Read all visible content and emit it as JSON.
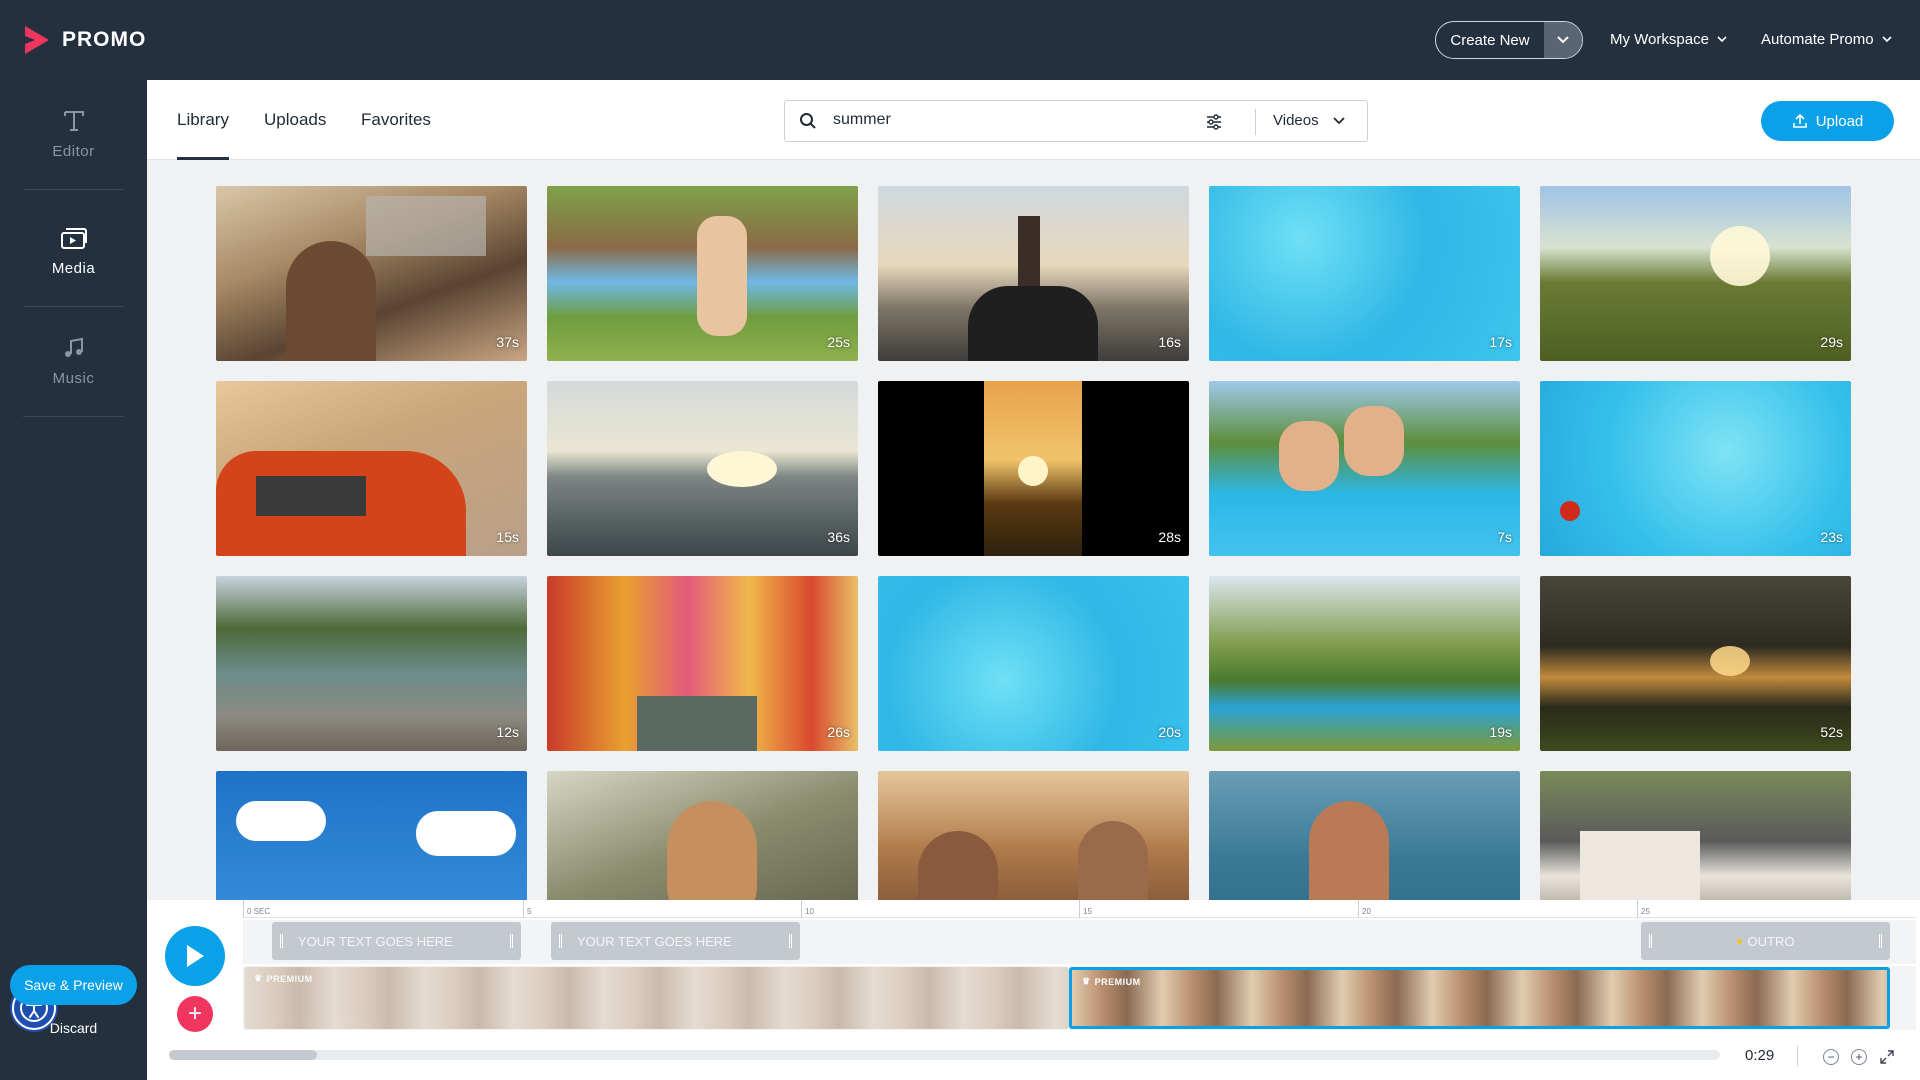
{
  "app": {
    "logo_text": "PROMO"
  },
  "topbar": {
    "create_new": "Create New",
    "workspace": "My Workspace",
    "automate": "Automate Promo"
  },
  "sidebar": {
    "items": [
      {
        "label": "Editor",
        "icon": "text-icon"
      },
      {
        "label": "Media",
        "icon": "media-icon"
      },
      {
        "label": "Music",
        "icon": "music-note-icon"
      }
    ],
    "save_preview": "Save & Preview",
    "discard": "Discard"
  },
  "tabs": [
    "Library",
    "Uploads",
    "Favorites"
  ],
  "search": {
    "value": "summer",
    "type_selected": "Videos"
  },
  "upload_label": "Upload",
  "grid": {
    "tiles": [
      {
        "duration": "37s",
        "scene": "festival crowd"
      },
      {
        "duration": "25s",
        "scene": "backyard pool"
      },
      {
        "duration": "16s",
        "scene": "boat at sunset"
      },
      {
        "duration": "17s",
        "scene": "pool water"
      },
      {
        "duration": "29s",
        "scene": "meadow sunset"
      },
      {
        "duration": "15s",
        "scene": "red car road trip"
      },
      {
        "duration": "36s",
        "scene": "sea sunset"
      },
      {
        "duration": "28s",
        "scene": "sunflowers vertical"
      },
      {
        "duration": "7s",
        "scene": "pool party jump"
      },
      {
        "duration": "23s",
        "scene": "kids swimming"
      },
      {
        "duration": "12s",
        "scene": "kayaking lake"
      },
      {
        "duration": "26s",
        "scene": "colorful village"
      },
      {
        "duration": "20s",
        "scene": "pool water"
      },
      {
        "duration": "19s",
        "scene": "garden pool"
      },
      {
        "duration": "52s",
        "scene": "river sunset"
      },
      {
        "duration": "",
        "scene": "blue sky clouds"
      },
      {
        "duration": "",
        "scene": "girl water splash"
      },
      {
        "duration": "",
        "scene": "festival dancing"
      },
      {
        "duration": "",
        "scene": "woman in sea"
      },
      {
        "duration": "",
        "scene": "house porch"
      }
    ]
  },
  "timeline": {
    "ticks": [
      "0 SEC",
      "5",
      "10",
      "15",
      "20",
      "25"
    ],
    "text_clips": [
      "YOUR TEXT GOES HERE",
      "YOUR TEXT GOES HERE"
    ],
    "outro_label": "OUTRO",
    "premium_label": "PREMIUM",
    "time": "0:29",
    "colors": {
      "accent": "#0aa1e8",
      "add": "#f0355f",
      "bar": "#24303e"
    }
  }
}
